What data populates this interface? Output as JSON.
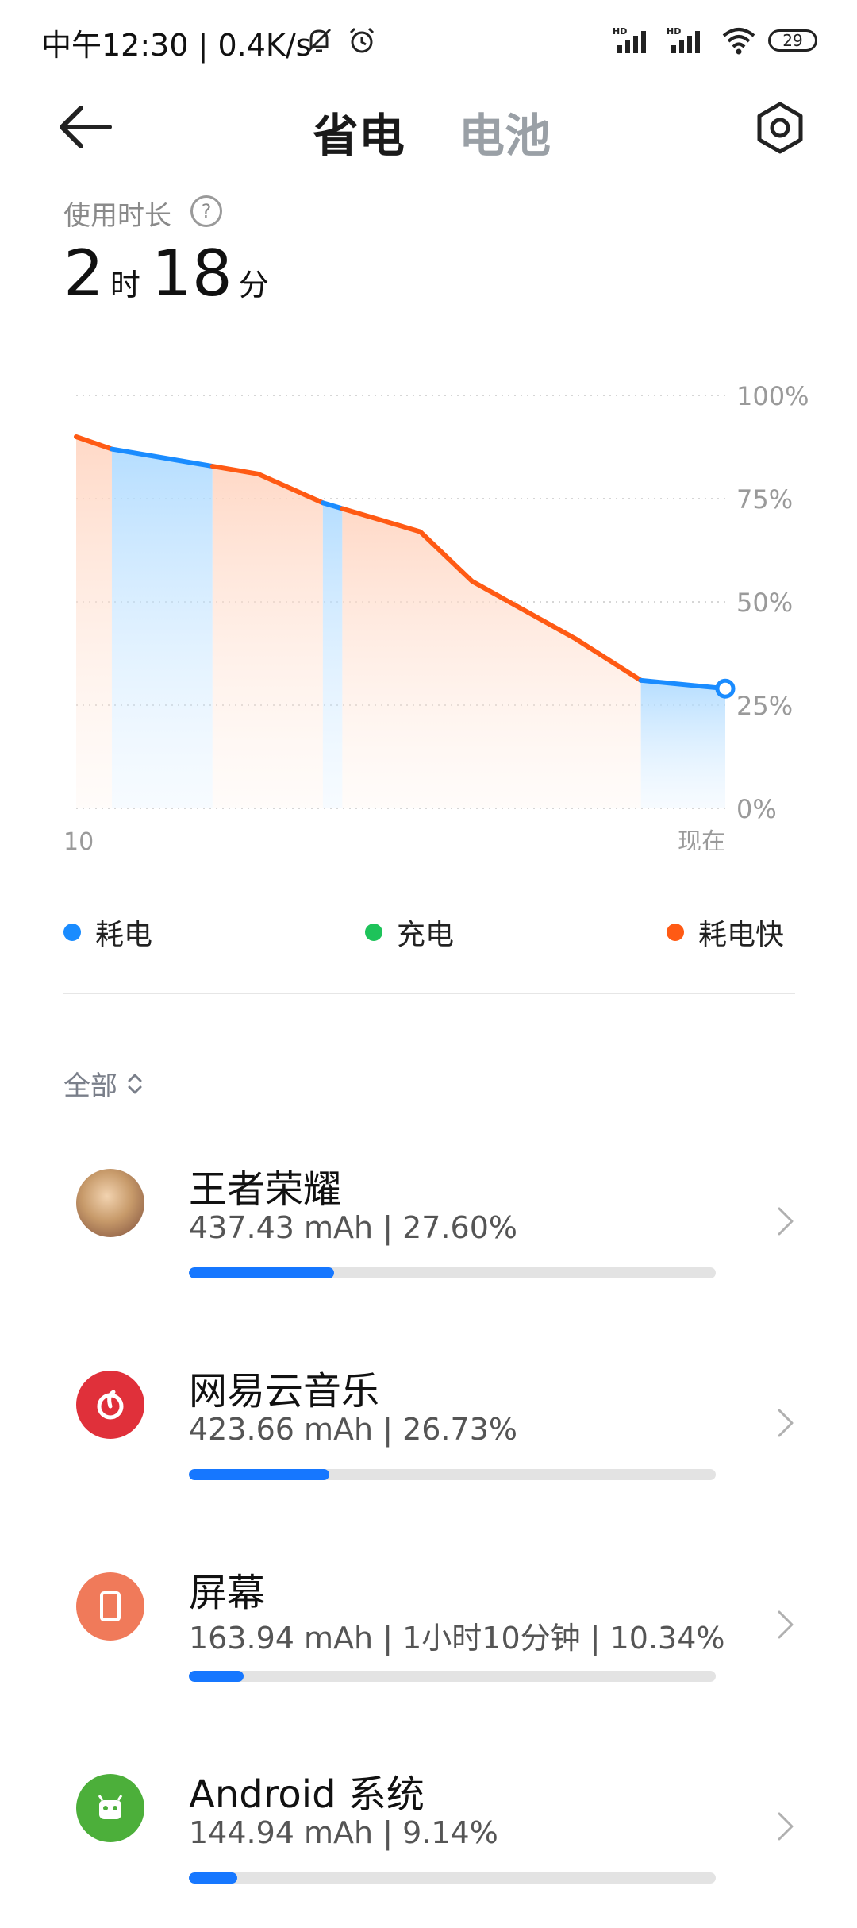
{
  "status_bar": {
    "left_text": "中午12:30 | 0.4K/s",
    "battery_level": "29",
    "icons": [
      "mute-bell-icon",
      "alarm-icon",
      "hd-signal-icon",
      "hd-signal-icon",
      "wifi-icon",
      "battery-icon"
    ]
  },
  "header": {
    "tabs": [
      {
        "label": "省电",
        "active": true
      },
      {
        "label": "电池",
        "active": false
      }
    ],
    "icons": [
      "back-arrow-icon",
      "settings-hexagon-icon"
    ]
  },
  "usage": {
    "label": "使用时长",
    "hours": "2",
    "hour_unit": "时",
    "minutes": "18",
    "minute_unit": "分"
  },
  "chart_data": {
    "type": "area",
    "x_start_label": "10",
    "x_end_label": "现在",
    "y_ticks": [
      "100%",
      "75%",
      "50%",
      "25%",
      "0%"
    ],
    "ylim": [
      0,
      100
    ],
    "x": [
      0,
      0.055,
      0.28,
      0.38,
      0.53,
      0.61,
      0.77,
      0.87,
      1.0
    ],
    "battery_level": [
      90,
      87,
      81,
      74,
      67,
      55,
      41,
      31,
      29
    ],
    "segments": [
      {
        "type": "耗电快",
        "from": 0.0,
        "to": 0.055
      },
      {
        "type": "耗电",
        "from": 0.055,
        "to": 0.21
      },
      {
        "type": "耗电快",
        "from": 0.21,
        "to": 0.38
      },
      {
        "type": "耗电",
        "from": 0.38,
        "to": 0.41
      },
      {
        "type": "耗电快",
        "from": 0.41,
        "to": 0.87
      },
      {
        "type": "耗电",
        "from": 0.87,
        "to": 1.0
      }
    ],
    "legend": [
      {
        "label": "耗电",
        "color": "#1a8cff"
      },
      {
        "label": "充电",
        "color": "#1ec35a"
      },
      {
        "label": "耗电快",
        "color": "#ff5a14"
      }
    ]
  },
  "filter": {
    "label": "全部"
  },
  "apps": [
    {
      "name": "王者荣耀",
      "stats": "437.43 mAh | 27.60%",
      "fraction": 0.276,
      "icon": "honor-of-kings-icon",
      "icon_color": "#c79a6a"
    },
    {
      "name": "网易云音乐",
      "stats": "423.66 mAh | 26.73%",
      "fraction": 0.2673,
      "icon": "netease-music-icon",
      "icon_color": "#e0303a"
    },
    {
      "name": "屏幕",
      "stats": "163.94 mAh | 1小时10分钟 | 10.34%",
      "fraction": 0.1034,
      "icon": "screen-icon",
      "icon_color": "#f07a5a"
    },
    {
      "name": "Android 系统",
      "stats": "144.94 mAh | 9.14%",
      "fraction": 0.0914,
      "icon": "android-icon",
      "icon_color": "#4caf3a"
    }
  ]
}
